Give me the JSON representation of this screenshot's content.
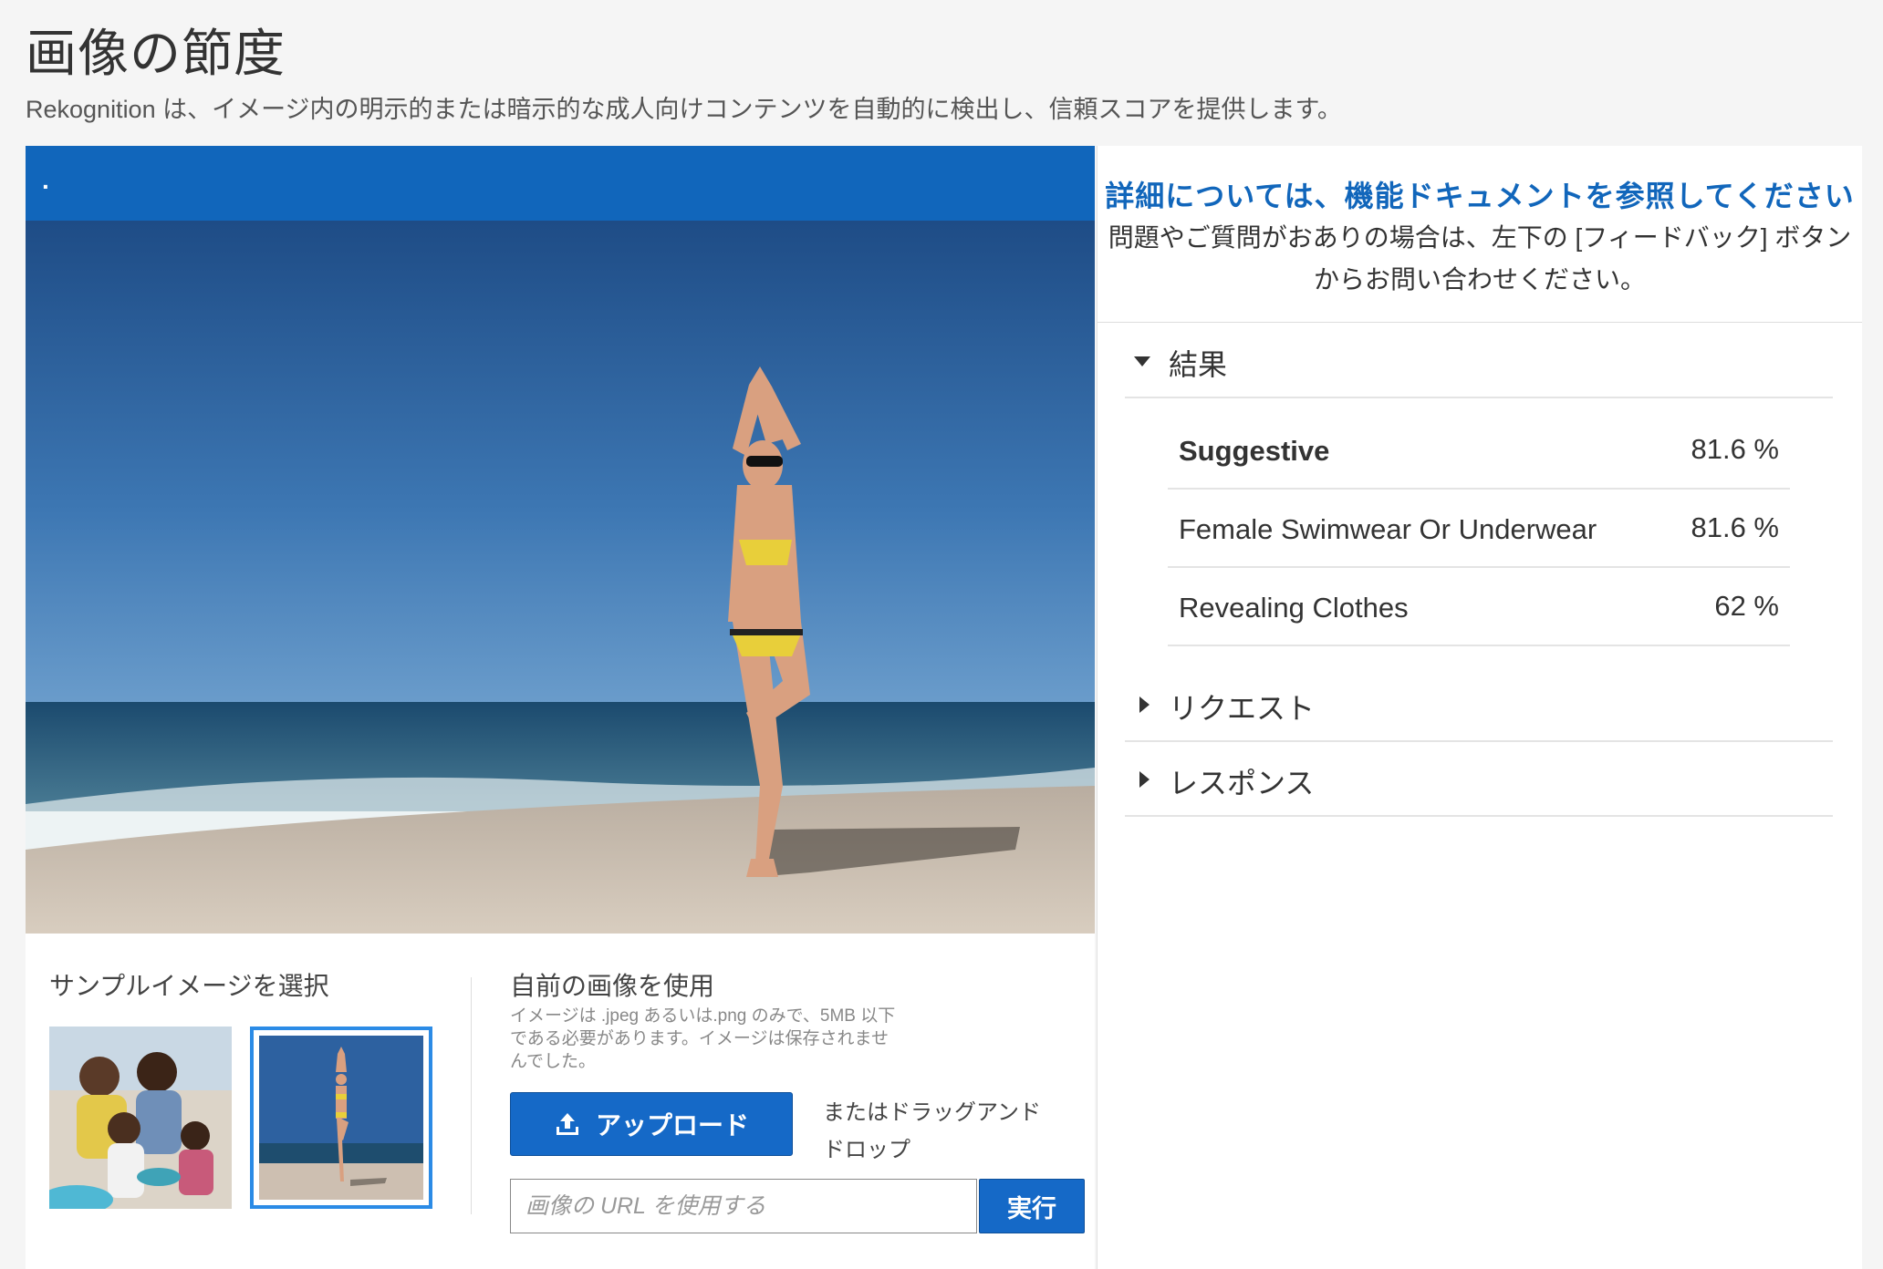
{
  "header": {
    "title": "画像の節度",
    "subtitle": "Rekognition は、イメージ内の明示的または暗示的な成人向けコンテンツを自動的に検出し、信頼スコアを提供します。"
  },
  "image_panel": {
    "topbar_text": ".",
    "sample_title": "サンプルイメージを選択",
    "own_title": "自前の画像を使用",
    "own_note": "イメージは .jpeg あるいは.png のみで、5MB 以下である必要があります。イメージは保存されませんでした。",
    "upload_label": "アップロード",
    "drag_drop_text": "またはドラッグアンドドロップ",
    "url_placeholder": "画像の URL を使用する",
    "run_label": "実行"
  },
  "right_panel": {
    "doc_link": "詳細については、機能ドキュメントを参照してください",
    "help_text": "問題やご質問がおありの場合は、左下の [フィードバック] ボタンからお問い合わせください。",
    "results_label": "結果",
    "results": [
      {
        "name": "Suggestive",
        "confidence": "81.6 %"
      },
      {
        "name": "Female Swimwear Or Underwear",
        "confidence": "81.6 %"
      },
      {
        "name": "Revealing Clothes",
        "confidence": "62 %"
      }
    ],
    "request_label": "リクエスト",
    "response_label": "レスポンス"
  },
  "colors": {
    "accent": "#1166bb",
    "button": "#1569c7",
    "selected_border": "#2b8be6"
  },
  "icons": [
    "upload-icon",
    "caret-down-icon",
    "caret-right-icon"
  ]
}
